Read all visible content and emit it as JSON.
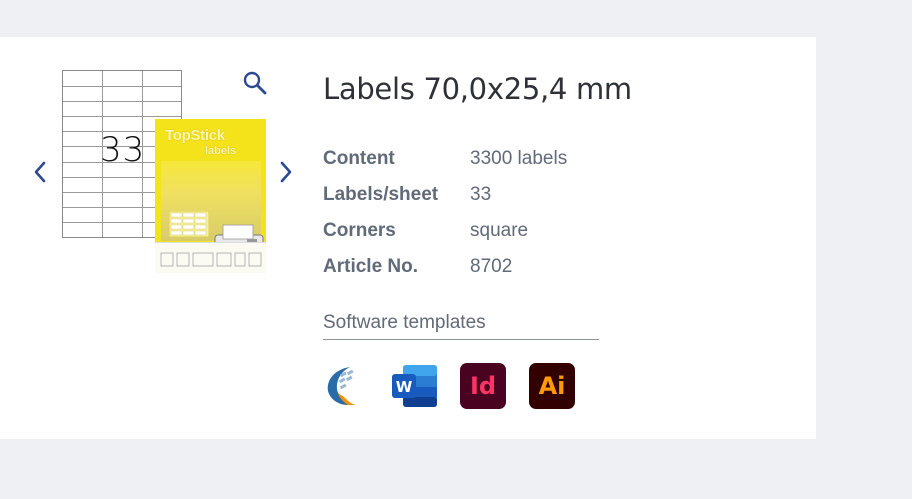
{
  "product": {
    "title": "Labels 70,0x25,4 mm",
    "sheet_preview_count": "33",
    "package": {
      "brand": "TopStick",
      "subtitle": "labels"
    }
  },
  "specs": [
    {
      "label": "Content",
      "value": "3300 labels"
    },
    {
      "label": "Labels/sheet",
      "value": "33"
    },
    {
      "label": "Corners",
      "value": "square"
    },
    {
      "label": "Article No.",
      "value": "8702"
    }
  ],
  "software": {
    "heading": "Software templates",
    "items": [
      {
        "name": "TopStick",
        "icon": "topstick-icon"
      },
      {
        "name": "Word",
        "icon": "word-icon",
        "letter": "W"
      },
      {
        "name": "InDesign",
        "icon": "indesign-icon",
        "letters": "Id"
      },
      {
        "name": "Illustrator",
        "icon": "illustrator-icon",
        "letters": "Ai"
      }
    ]
  },
  "colors": {
    "page_bg": "#eff0f4",
    "card_bg": "#ffffff",
    "text_primary": "#2e3136",
    "text_secondary": "#616a78",
    "accent": "#2c4a94",
    "package_yellow": "#f4e21a"
  },
  "icons": [
    "chevron-left-icon",
    "chevron-right-icon",
    "zoom-icon"
  ]
}
